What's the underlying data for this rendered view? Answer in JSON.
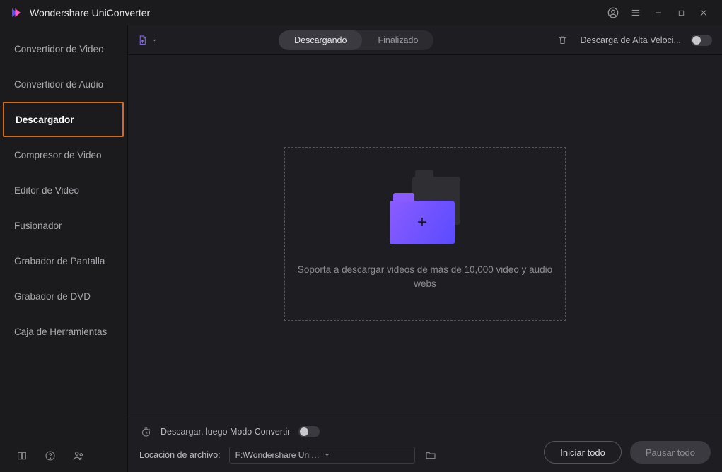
{
  "app": {
    "title": "Wondershare UniConverter"
  },
  "sidebar": {
    "items": [
      {
        "label": "Convertidor de Video"
      },
      {
        "label": "Convertidor de Audio"
      },
      {
        "label": "Descargador"
      },
      {
        "label": "Compresor de Video"
      },
      {
        "label": "Editor de Video"
      },
      {
        "label": "Fusionador"
      },
      {
        "label": "Grabador de Pantalla"
      },
      {
        "label": "Grabador de DVD"
      },
      {
        "label": "Caja de Herramientas"
      }
    ],
    "active_index": 2
  },
  "toolbar": {
    "tab_downloading": "Descargando",
    "tab_finished": "Finalizado",
    "high_speed_label": "Descarga de Alta Veloci..."
  },
  "dropzone": {
    "text": "Soporta a descargar videos de más de 10,000 video y audio webs"
  },
  "footer": {
    "convert_mode_label": "Descargar, luego Modo Convertir",
    "location_label": "Locación de archivo:",
    "location_path": "F:\\Wondershare UniConverter\\Downloaded",
    "start_all": "Iniciar todo",
    "pause_all": "Pausar todo"
  }
}
